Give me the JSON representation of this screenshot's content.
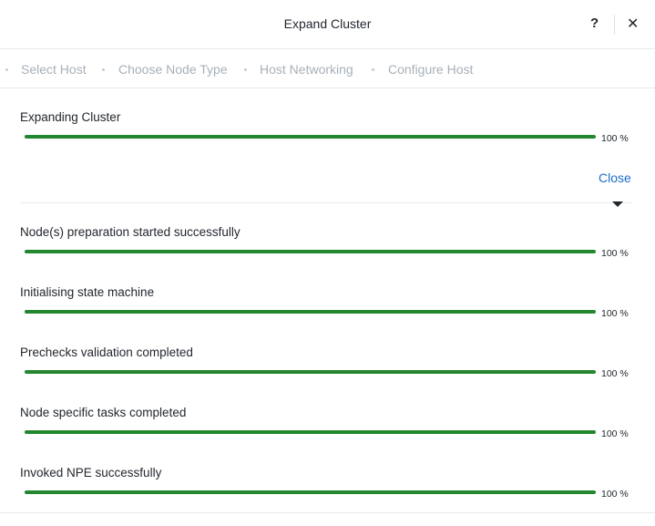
{
  "dialog": {
    "title": "Expand Cluster",
    "help_label": "?",
    "close_glyph": "✕"
  },
  "steps": [
    "Select Host",
    "Choose Node Type",
    "Host Networking",
    "Configure Host"
  ],
  "overall": {
    "label": "Expanding Cluster",
    "percent_text": "100 %",
    "progress": 1.0,
    "close_label": "Close"
  },
  "tasks": [
    {
      "label": "Node(s) preparation started successfully",
      "percent_text": "100 %",
      "progress": 1.0
    },
    {
      "label": "Initialising state machine",
      "percent_text": "100 %",
      "progress": 1.0
    },
    {
      "label": "Prechecks validation completed",
      "percent_text": "100 %",
      "progress": 1.0
    },
    {
      "label": "Node specific tasks completed",
      "percent_text": "100 %",
      "progress": 1.0
    },
    {
      "label": "Invoked NPE successfully",
      "percent_text": "100 %",
      "progress": 1.0
    }
  ],
  "colors": {
    "progress_fill": "#23872f",
    "link": "#1b6fc8",
    "inactive_step": "#a7b0b8"
  },
  "icons": {
    "help": "help-icon",
    "close": "close-icon",
    "expand": "caret-down-icon"
  }
}
